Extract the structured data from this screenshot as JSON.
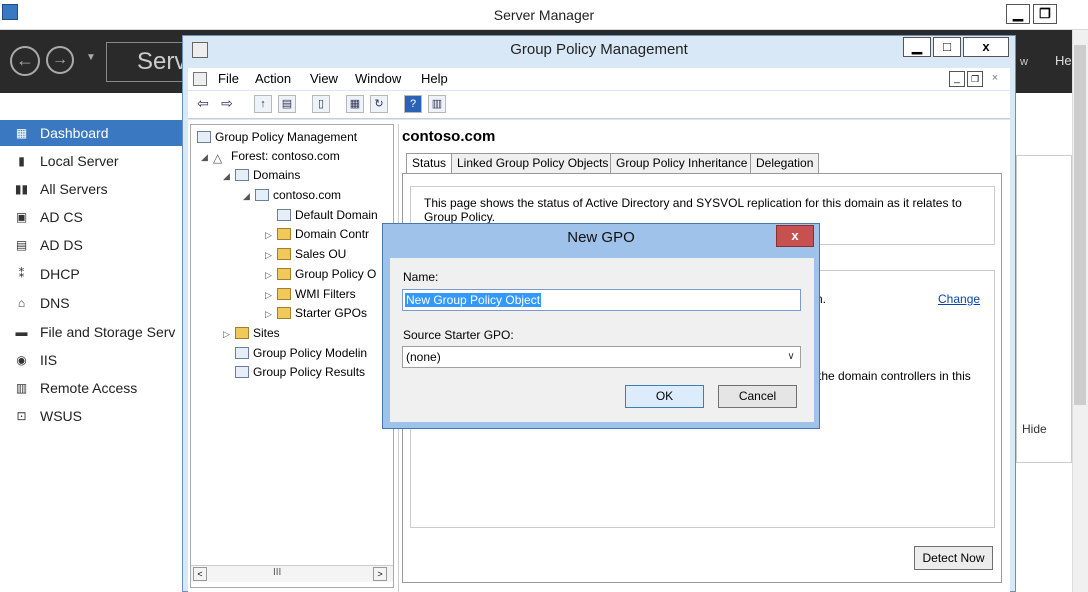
{
  "server_manager": {
    "title": "Server Manager",
    "breadcrumb": "Serv",
    "header_right_partial": [
      "w",
      "He"
    ],
    "sidebar": [
      {
        "label": "Dashboard",
        "icon": "dashboard-icon",
        "glyph": "▦",
        "active": true
      },
      {
        "label": "Local Server",
        "icon": "server-icon",
        "glyph": "▮",
        "active": false
      },
      {
        "label": "All Servers",
        "icon": "servers-icon",
        "glyph": "▮▮",
        "active": false
      },
      {
        "label": "AD CS",
        "icon": "certificate-icon",
        "glyph": "▣",
        "active": false
      },
      {
        "label": "AD DS",
        "icon": "directory-icon",
        "glyph": "▤",
        "active": false
      },
      {
        "label": "DHCP",
        "icon": "dhcp-icon",
        "glyph": "⁑",
        "active": false
      },
      {
        "label": "DNS",
        "icon": "dns-icon",
        "glyph": "⌂",
        "active": false
      },
      {
        "label": "File and Storage Serv",
        "icon": "storage-icon",
        "glyph": "▬",
        "active": false
      },
      {
        "label": "IIS",
        "icon": "iis-icon",
        "glyph": "◉",
        "active": false
      },
      {
        "label": "Remote Access",
        "icon": "remote-access-icon",
        "glyph": "▥",
        "active": false
      },
      {
        "label": "WSUS",
        "icon": "wsus-icon",
        "glyph": "⊡",
        "active": false
      }
    ],
    "hide_label": "Hide"
  },
  "gpmc": {
    "title": "Group Policy Management",
    "menu": [
      "File",
      "Action",
      "View",
      "Window",
      "Help"
    ],
    "tree": [
      {
        "label": "Group Policy Management",
        "indent": 0,
        "arrow": "",
        "icon": "gpm-icon"
      },
      {
        "label": "Forest: contoso.com",
        "indent": 1,
        "arrow": "◢",
        "icon": "forest-icon"
      },
      {
        "label": "Domains",
        "indent": 2,
        "arrow": "◢",
        "icon": "domains-icon"
      },
      {
        "label": "contoso.com",
        "indent": 3,
        "arrow": "◢",
        "icon": "domain-icon"
      },
      {
        "label": "Default Domain",
        "indent": 4,
        "arrow": "",
        "icon": "gpo-link-icon"
      },
      {
        "label": "Domain Contr",
        "indent": 4,
        "arrow": "▷",
        "icon": "ou-icon"
      },
      {
        "label": "Sales OU",
        "indent": 4,
        "arrow": "▷",
        "icon": "ou-icon"
      },
      {
        "label": "Group Policy O",
        "indent": 4,
        "arrow": "▷",
        "icon": "gpo-folder-icon"
      },
      {
        "label": "WMI Filters",
        "indent": 4,
        "arrow": "▷",
        "icon": "wmi-folder-icon"
      },
      {
        "label": "Starter GPOs",
        "indent": 4,
        "arrow": "▷",
        "icon": "starter-folder-icon"
      },
      {
        "label": "Sites",
        "indent": 1,
        "arrow": "▷",
        "icon": "sites-icon"
      },
      {
        "label": "Group Policy Modelin",
        "indent": 1,
        "arrow": "",
        "icon": "modeling-icon"
      },
      {
        "label": "Group Policy Results",
        "indent": 1,
        "arrow": "",
        "icon": "results-icon"
      }
    ],
    "scroll_mid": "III",
    "detail": {
      "title": "contoso.com",
      "tabs": [
        "Status",
        "Linked Group Policy Objects",
        "Group Policy Inheritance",
        "Delegation"
      ],
      "info": "This page shows the status of Active Directory and SYSVOL replication for this domain as it relates to Group Policy.",
      "fragment_1": "n.",
      "change_link": "Change",
      "fragment_2": "the domain controllers in this",
      "detect_now": "Detect Now"
    }
  },
  "dialog": {
    "title": "New GPO",
    "close": "x",
    "name_label": "Name:",
    "name_value": "New Group Policy Object",
    "source_label": "Source Starter GPO:",
    "source_value": "(none)",
    "ok": "OK",
    "cancel": "Cancel"
  }
}
